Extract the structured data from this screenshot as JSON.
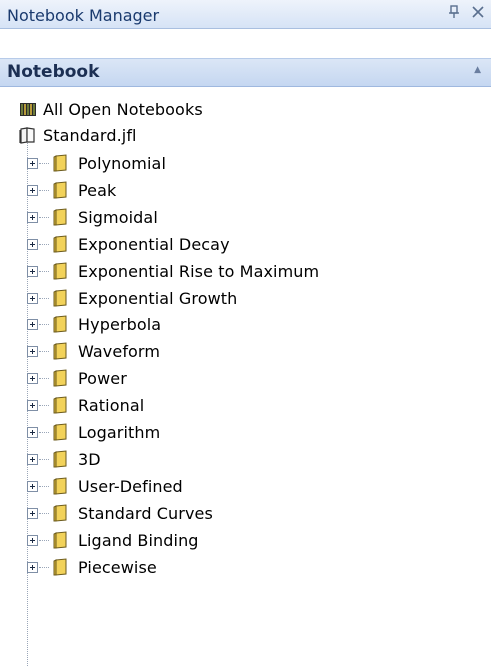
{
  "window": {
    "title": "Notebook Manager",
    "pin_glyph": "ᚔ",
    "close_glyph": "✕"
  },
  "section": {
    "label": "Notebook",
    "collapse_glyph": "▲"
  },
  "tree": {
    "all_open": "All Open Notebooks",
    "notebook": "Standard.jfl",
    "folders": [
      "Polynomial",
      "Peak",
      "Sigmoidal",
      "Exponential Decay",
      "Exponential Rise to Maximum",
      "Exponential Growth",
      "Hyperbola",
      "Waveform",
      "Power",
      "Rational",
      "Logarithm",
      "3D",
      "User-Defined",
      "Standard Curves",
      "Ligand Binding",
      "Piecewise"
    ]
  },
  "icons": {
    "all_open": "notebooks-stack-icon",
    "notebook": "open-book-icon",
    "folder": "folder-icon",
    "expander": "plus-expander-icon"
  },
  "colors": {
    "title_text": "#1a3a6e",
    "folder_fill": "#f2d25a",
    "header_bg": "#c5d7f1"
  }
}
